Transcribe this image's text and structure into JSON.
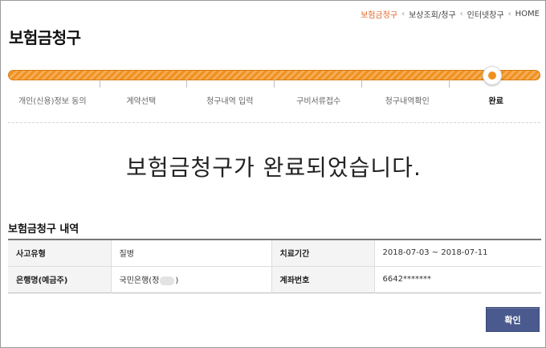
{
  "breadcrumb": {
    "items": [
      "보험금청구",
      "보상조회/청구",
      "인터넷창구",
      "HOME"
    ]
  },
  "page_title": "보험금청구",
  "progress": {
    "steps": [
      "개인(신용)정보 동의",
      "계약선택",
      "청구내역 입력",
      "구비서류접수",
      "청구내역확인",
      "완료"
    ],
    "current_step": 6,
    "accent_color": "#f0901e"
  },
  "complete_message": "보험금청구가 완료되었습니다.",
  "details": {
    "section_title": "보험금청구 내역",
    "rows": [
      {
        "label1": "사고유형",
        "value1": "질병",
        "label2": "치료기간",
        "value2": "2018-07-03 ~ 2018-07-11"
      },
      {
        "label1": "은행명(예금주)",
        "value1_prefix": "국민은행(정",
        "value1_suffix": ")",
        "label2": "계좌번호",
        "value2": "6642*******"
      }
    ]
  },
  "confirm_button": {
    "label": "확인",
    "color": "#4a5a8e"
  }
}
